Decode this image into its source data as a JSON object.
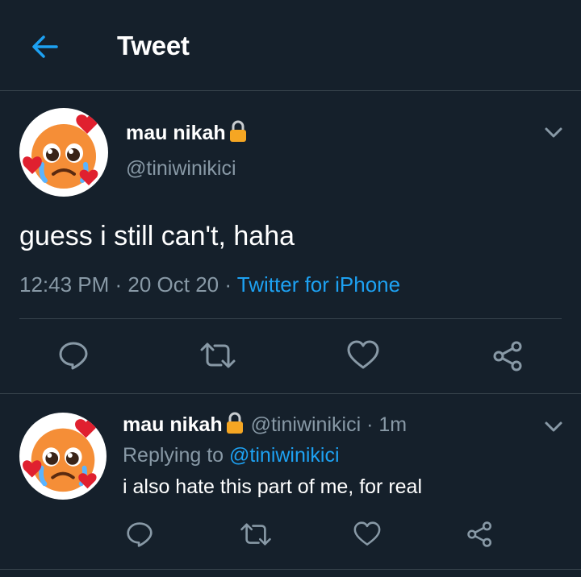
{
  "header": {
    "title": "Tweet"
  },
  "tweet": {
    "author_name": "mau nikah",
    "author_handle": "@tiniwinikici",
    "text": "guess i still can't, haha",
    "time": "12:43 PM",
    "sep1": " · ",
    "date": "20 Oct 20",
    "sep2": " · ",
    "source": "Twitter for iPhone"
  },
  "reply": {
    "author_name": "mau nikah",
    "author_handle": "@tiniwinikici",
    "sep": " · ",
    "age": "1m",
    "replying_prefix": "Replying to ",
    "replying_to": "@tiniwinikici",
    "text": "i also hate this part of me, for real"
  },
  "icons": {
    "back": "arrow-left-icon",
    "lock": "lock-icon",
    "chevron": "chevron-down-icon",
    "reply": "reply-icon",
    "retweet": "retweet-icon",
    "like": "heart-icon",
    "share": "share-icon",
    "avatar": "pleading-face-emoji"
  },
  "colors": {
    "background": "#15202b",
    "accent": "#1da1f2",
    "muted": "#8899a6",
    "divider": "#38444d"
  }
}
